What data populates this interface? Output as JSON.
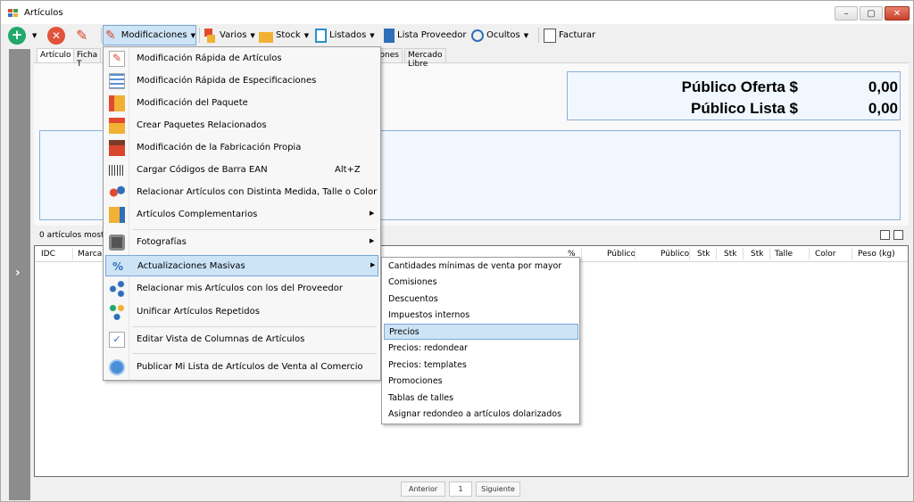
{
  "window": {
    "title": "Artículos",
    "controls": [
      "–",
      "▢",
      "✕"
    ]
  },
  "toolbar": {
    "add_label": "",
    "delete_label": "",
    "edit_label": "",
    "modificaciones": "Modificaciones",
    "varios": "Varios",
    "stock": "Stock",
    "listados": "Listados",
    "lista_proveedor": "Lista Proveedor",
    "ocultos": "Ocultos",
    "facturar": "Facturar"
  },
  "tabs": [
    "Artículo",
    "Ficha T",
    "iones",
    "Mercado Libre"
  ],
  "prices": {
    "oferta_label": "Público Oferta $",
    "oferta_value": "0,00",
    "lista_label": "Público Lista $",
    "lista_value": "0,00"
  },
  "status": {
    "count_text": "0 artículos mostra"
  },
  "grid": {
    "columns": [
      "IDC",
      "Marca",
      "%",
      "Público",
      "Público",
      "Stk",
      "Stk",
      "Stk",
      "Talle",
      "Color",
      "Peso (kg)"
    ]
  },
  "pager": {
    "prev": "Anterior",
    "page": "1",
    "next": "Siguiente"
  },
  "menu": {
    "items": [
      {
        "label": "Modificación Rápida de Artículos",
        "icon": "pencil-doc-icon"
      },
      {
        "label": "Modificación Rápida de Especificaciones",
        "icon": "list-icon"
      },
      {
        "label": "Modificación del Paquete",
        "icon": "package-icon"
      },
      {
        "label": "Crear Paquetes Relacionados",
        "icon": "package-link-icon"
      },
      {
        "label": "Modificación de la Fabricación Propia",
        "icon": "factory-icon"
      },
      {
        "label": "Cargar Códigos de Barra EAN",
        "icon": "barcode-icon",
        "shortcut": "Alt+Z"
      },
      {
        "label": "Relacionar Artículos con Distinta Medida, Talle o Color",
        "icon": "relate-icon"
      },
      {
        "label": "Artículos Complementarios",
        "icon": "complement-icon",
        "arrow": "▶"
      },
      {
        "label": "Fotografías",
        "icon": "camera-icon",
        "arrow": "▶"
      },
      {
        "label": "Actualizaciones Masivas",
        "icon": "percent-icon",
        "arrow": "▶"
      },
      {
        "label": "Relacionar mis Artículos con los del Proveedor",
        "icon": "share-icon"
      },
      {
        "label": "Unificar Artículos Repetidos",
        "icon": "merge-icon"
      },
      {
        "label": "Editar Vista de Columnas de Artículos",
        "icon": "checklist-icon"
      },
      {
        "label": "Publicar Mi Lista de Artículos de Venta al Comercio",
        "icon": "globe-icon"
      }
    ]
  },
  "submenu": {
    "items": [
      "Cantidades mínimas de venta por mayor",
      "Comisiones",
      "Descuentos",
      "Impuestos internos",
      "Precios",
      "Precios: redondear",
      "Precios: templates",
      "Promociones",
      "Tablas de talles",
      "Asignar redondeo a artículos dolarizados"
    ]
  },
  "colors": {
    "highlight": "#cde4f7",
    "highlight_border": "#7aa7d6",
    "price_box": "#f0f7ff"
  }
}
